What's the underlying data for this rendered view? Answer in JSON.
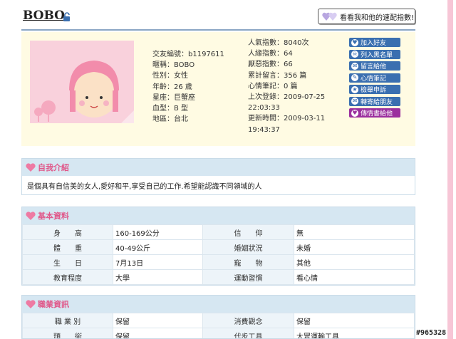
{
  "header": {
    "username": "BOBO",
    "match_button_label": "看看我和他的速配指數!"
  },
  "profile": {
    "left_info": [
      {
        "label": "交友編號",
        "value": "b1197611"
      },
      {
        "label": "暱稱",
        "value": "BOBO"
      },
      {
        "label": "性別",
        "value": "女性"
      },
      {
        "label": "年齡",
        "value": "26 歲"
      },
      {
        "label": "星座",
        "value": "巨蟹座"
      },
      {
        "label": "血型",
        "value": "B 型"
      },
      {
        "label": "地區",
        "value": "台北"
      }
    ],
    "mid_info": [
      {
        "label": "人氣指數",
        "value": "8040次"
      },
      {
        "label": "人緣指數",
        "value": "64"
      },
      {
        "label": "厭惡指數",
        "value": "66"
      },
      {
        "label": "累計留言",
        "value": "356 篇"
      },
      {
        "label": "心情筆記",
        "value": "0 篇"
      },
      {
        "label": "上次登錄",
        "value": "2009-07-25",
        "value2": "22:03:33"
      },
      {
        "label": "更新時間",
        "value": "2009-03-11",
        "value2": "19:43:37"
      }
    ],
    "actions": [
      {
        "label": "加入好友",
        "icon": "heart-icon",
        "glyph": "♥"
      },
      {
        "label": "列入黑名單",
        "icon": "skull-icon",
        "glyph": "☠"
      },
      {
        "label": "留言給他",
        "icon": "speech-bubble-icon",
        "glyph": "✉"
      },
      {
        "label": "心情筆記",
        "icon": "pencil-icon",
        "glyph": "✎"
      },
      {
        "label": "檢舉申訴",
        "icon": "star-icon",
        "glyph": "★"
      },
      {
        "label": "轉寄給朋友",
        "icon": "mail-icon",
        "glyph": "✉"
      },
      {
        "label": "傳情書給他",
        "icon": "love-letter-icon",
        "glyph": "♥"
      }
    ]
  },
  "intro": {
    "title": "自我介紹",
    "text": "是個具有自信美的女人,愛好和平,享受自己的工作.希望能認識不同領域的人"
  },
  "basic": {
    "title": "基本資料",
    "rows": [
      {
        "k1": "身　　高",
        "v1": "160-169公分",
        "k2": "信　　仰",
        "v2": "無"
      },
      {
        "k1": "體　　重",
        "v1": "40-49公斤",
        "k2": "婚姻狀況",
        "v2": "未婚"
      },
      {
        "k1": "生　　日",
        "v1": "7月13日",
        "k2": "寵　　物",
        "v2": "其他"
      },
      {
        "k1": "教育程度",
        "v1": "大學",
        "k2": "運動習慣",
        "v2": "看心情"
      }
    ]
  },
  "job": {
    "title": "職業資訊",
    "rows": [
      {
        "k1": "職 業 別",
        "v1": "保留",
        "k2": "消費觀念",
        "v2": "保留"
      },
      {
        "k1": "頭　　銜",
        "v1": "保留",
        "k2": "代步工具",
        "v2": "大眾運輸工具"
      }
    ]
  },
  "watermark": "#965328",
  "colors": {
    "accent_pink": "#e0588a",
    "action_blue": "#3a6fb0",
    "action_purple": "#9b2f9e",
    "section_blue": "#d6e7f2"
  }
}
